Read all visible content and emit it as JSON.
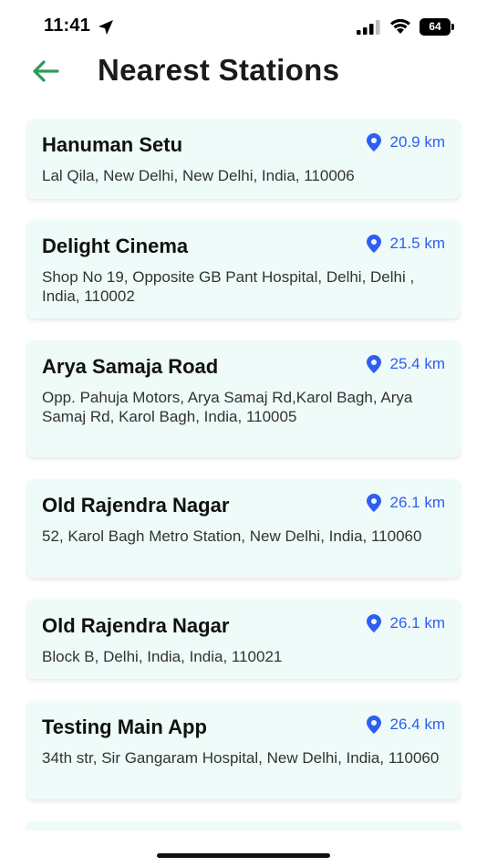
{
  "status_bar": {
    "time": "11:41",
    "battery": "64"
  },
  "header": {
    "title": "Nearest Stations"
  },
  "colors": {
    "accent_green": "#2e9a57",
    "distance_blue": "#2f5ef0",
    "card_background": "#eefbf9"
  },
  "stations": [
    {
      "name": "Hanuman Setu",
      "distance": "20.9 km",
      "address": "Lal Qila, New Delhi, New Delhi, India, 110006"
    },
    {
      "name": "Delight Cinema",
      "distance": "21.5 km",
      "address": "Shop No 19, Opposite GB  Pant Hospital, Delhi, Delhi , India, 110002"
    },
    {
      "name": "Arya Samaja Road",
      "distance": "25.4 km",
      "address": "Opp. Pahuja Motors, Arya Samaj Rd,Karol Bagh, Arya Samaj Rd, Karol Bagh, India, 110005"
    },
    {
      "name": "Old Rajendra Nagar",
      "distance": "26.1 km",
      "address": "52, Karol Bagh Metro Station, New Delhi, India, 110060"
    },
    {
      "name": "Old Rajendra Nagar",
      "distance": "26.1 km",
      "address": "Block B, Delhi, India, India, 110021"
    },
    {
      "name": "Testing Main App",
      "distance": "26.4 km",
      "address": "34th str, Sir Gangaram Hospital, New Delhi, India, 110060"
    }
  ]
}
